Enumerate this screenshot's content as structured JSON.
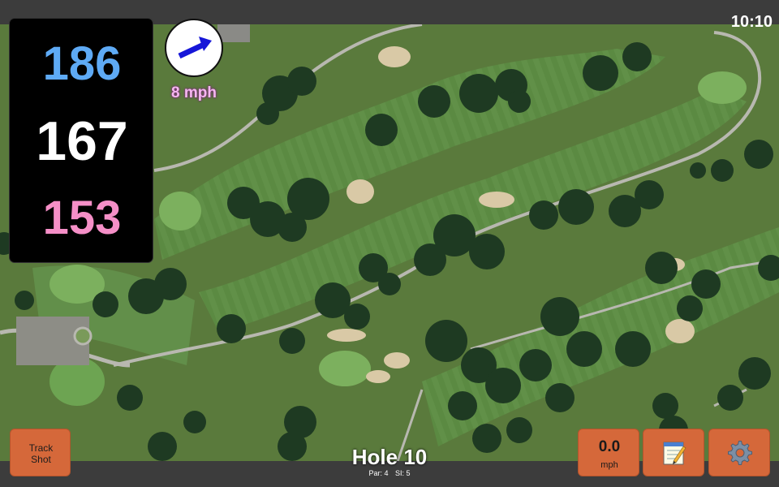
{
  "status_bar": {
    "time": "10:10"
  },
  "distances": {
    "back": "186",
    "middle": "167",
    "front": "153"
  },
  "wind": {
    "speed_label": "8 mph",
    "direction_icon": "arrow-icon"
  },
  "track_shot": {
    "line1": "Track",
    "line2": "Shot"
  },
  "speed": {
    "value": "0.0",
    "unit": "mph"
  },
  "notes": {
    "icon": "notepad-icon"
  },
  "settings": {
    "icon": "gear-icon"
  },
  "hole": {
    "title": "Hole 10",
    "par": "Par: 4",
    "si": "SI: 5"
  },
  "colors": {
    "back": "#5eaaf5",
    "middle": "#ffffff",
    "front": "#f58fc7",
    "button": "#d5683a",
    "wind_text": "#f5b6f0"
  }
}
